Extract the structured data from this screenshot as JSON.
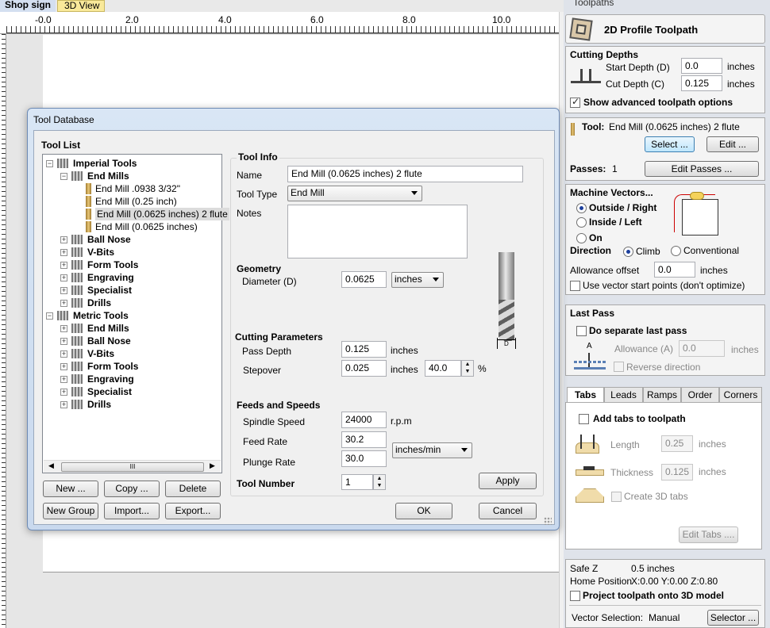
{
  "tabs": {
    "shop_sign": "Shop sign",
    "view3d": "3D View"
  },
  "ruler": {
    "labels": [
      "-0.0",
      "2.0",
      "4.0",
      "6.0",
      "8.0",
      "10.0"
    ]
  },
  "panel_title": "Toolpaths",
  "toolpath_name": "2D Profile Toolpath",
  "cutting_depths": {
    "heading": "Cutting Depths",
    "start_label": "Start Depth (D)",
    "start_value": "0.0",
    "start_unit": "inches",
    "cut_label": "Cut Depth (C)",
    "cut_value": "0.125",
    "cut_unit": "inches",
    "advanced_label": "Show advanced toolpath options"
  },
  "tool": {
    "label": "Tool:",
    "name": "End Mill (0.0625 inches) 2 flute",
    "select_btn": "Select ...",
    "edit_btn": "Edit ...",
    "passes_label": "Passes:",
    "passes_value": "1",
    "edit_passes_btn": "Edit Passes ..."
  },
  "machine_vectors": {
    "heading": "Machine Vectors...",
    "outside": "Outside / Right",
    "inside": "Inside / Left",
    "on": "On",
    "direction_label": "Direction",
    "climb": "Climb",
    "conventional": "Conventional",
    "allowance_label": "Allowance offset",
    "allowance_value": "0.0",
    "allowance_unit": "inches",
    "vector_start": "Use vector start points (don't optimize)"
  },
  "last_pass": {
    "heading": "Last Pass",
    "separate": "Do separate last pass",
    "allowance_label": "Allowance (A)",
    "allowance_value": "0.0",
    "allowance_unit": "inches",
    "reverse": "Reverse direction"
  },
  "subtabs": [
    "Tabs",
    "Leads",
    "Ramps",
    "Order",
    "Corners"
  ],
  "tabs_panel": {
    "add_tabs": "Add tabs to toolpath",
    "length_label": "Length",
    "length_value": "0.25",
    "length_unit": "inches",
    "thickness_label": "Thickness",
    "thickness_value": "0.125",
    "thickness_unit": "inches",
    "create_3d": "Create 3D tabs",
    "edit_tabs_btn": "Edit Tabs ...."
  },
  "footer": {
    "safe_z_label": "Safe Z",
    "safe_z_value": "0.5 inches",
    "home_label": "Home Position",
    "home_value": "X:0.00 Y:0.00 Z:0.80",
    "project": "Project toolpath onto 3D model",
    "vector_sel_label": "Vector Selection:",
    "vector_sel_value": "Manual",
    "selector_btn": "Selector ..."
  },
  "dialog": {
    "title": "Tool Database",
    "tool_list_label": "Tool List",
    "tree": [
      {
        "text": "Imperial Tools",
        "level": 0,
        "bold": true,
        "exp": "-",
        "icon": "group"
      },
      {
        "text": "End Mills",
        "level": 1,
        "bold": true,
        "exp": "-",
        "icon": "group"
      },
      {
        "text": "End Mill .0938 3/32\"",
        "level": 2,
        "bold": false,
        "exp": "",
        "icon": "bit"
      },
      {
        "text": "End Mill (0.25 inch)",
        "level": 2,
        "bold": false,
        "exp": "",
        "icon": "bit"
      },
      {
        "text": "End Mill (0.0625 inches) 2 flute",
        "level": 2,
        "bold": false,
        "exp": "",
        "icon": "bit",
        "selected": true
      },
      {
        "text": "End Mill (0.0625 inches)",
        "level": 2,
        "bold": false,
        "exp": "",
        "icon": "bit"
      },
      {
        "text": "Ball Nose",
        "level": 1,
        "bold": true,
        "exp": "+",
        "icon": "group"
      },
      {
        "text": "V-Bits",
        "level": 1,
        "bold": true,
        "exp": "+",
        "icon": "group"
      },
      {
        "text": "Form Tools",
        "level": 1,
        "bold": true,
        "exp": "+",
        "icon": "group"
      },
      {
        "text": "Engraving",
        "level": 1,
        "bold": true,
        "exp": "+",
        "icon": "group"
      },
      {
        "text": "Specialist",
        "level": 1,
        "bold": true,
        "exp": "+",
        "icon": "group"
      },
      {
        "text": "Drills",
        "level": 1,
        "bold": true,
        "exp": "+",
        "icon": "group"
      },
      {
        "text": "Metric Tools",
        "level": 0,
        "bold": true,
        "exp": "-",
        "icon": "group"
      },
      {
        "text": "End Mills",
        "level": 1,
        "bold": true,
        "exp": "+",
        "icon": "group"
      },
      {
        "text": "Ball Nose",
        "level": 1,
        "bold": true,
        "exp": "+",
        "icon": "group"
      },
      {
        "text": "V-Bits",
        "level": 1,
        "bold": true,
        "exp": "+",
        "icon": "group"
      },
      {
        "text": "Form Tools",
        "level": 1,
        "bold": true,
        "exp": "+",
        "icon": "group"
      },
      {
        "text": "Engraving",
        "level": 1,
        "bold": true,
        "exp": "+",
        "icon": "group"
      },
      {
        "text": "Specialist",
        "level": 1,
        "bold": true,
        "exp": "+",
        "icon": "group"
      },
      {
        "text": "Drills",
        "level": 1,
        "bold": true,
        "exp": "+",
        "icon": "group"
      }
    ],
    "scroll_thumb": "III",
    "buttons": {
      "new": "New ...",
      "copy": "Copy ...",
      "delete": "Delete",
      "new_group": "New Group",
      "import": "Import...",
      "export": "Export...",
      "apply": "Apply",
      "ok": "OK",
      "cancel": "Cancel"
    },
    "tool_info": {
      "heading": "Tool Info",
      "name_label": "Name",
      "name_value": "End Mill (0.0625 inches) 2 flute",
      "type_label": "Tool Type",
      "type_value": "End Mill",
      "notes_label": "Notes"
    },
    "geometry": {
      "heading": "Geometry",
      "diameter_label": "Diameter (D)",
      "diameter_value": "0.0625",
      "unit": "inches",
      "diagram_label": "D"
    },
    "cutting": {
      "heading": "Cutting Parameters",
      "pass_label": "Pass Depth",
      "pass_value": "0.125",
      "pass_unit": "inches",
      "stepover_label": "Stepover",
      "stepover_value": "0.025",
      "stepover_unit": "inches",
      "stepover_pct": "40.0",
      "pct_sign": "%"
    },
    "feeds": {
      "heading": "Feeds and Speeds",
      "spindle_label": "Spindle Speed",
      "spindle_value": "24000",
      "spindle_unit": "r.p.m",
      "feed_label": "Feed Rate",
      "feed_value": "30.2",
      "plunge_label": "Plunge Rate",
      "plunge_value": "30.0",
      "rate_unit": "inches/min"
    },
    "tool_number": {
      "label": "Tool Number",
      "value": "1"
    }
  }
}
